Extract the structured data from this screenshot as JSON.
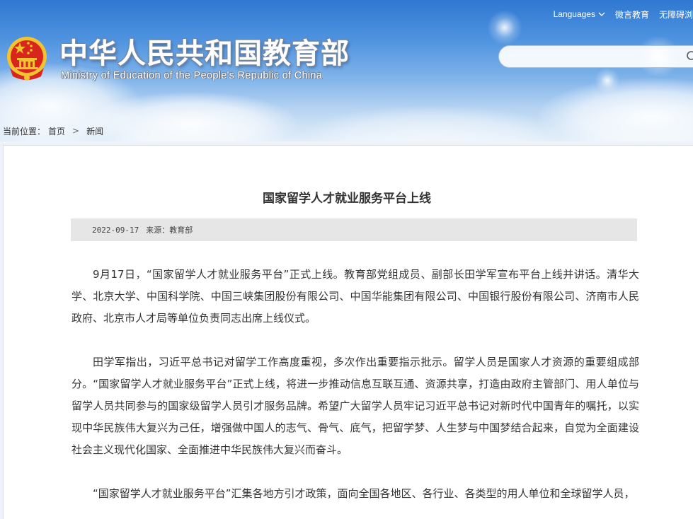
{
  "header": {
    "title": "中华人民共和国教育部",
    "subtitle": "Ministry of Education of the People's Republic of China",
    "links": {
      "languages": "Languages",
      "wechat": "微言教育",
      "accessibility": "无障碍浏"
    },
    "search": {
      "placeholder": ""
    }
  },
  "breadcrumb": {
    "prefix": "当前位置：",
    "home": "首页",
    "current": "新闻"
  },
  "article": {
    "title": "国家留学人才就业服务平台上线",
    "date": "2022-09-17",
    "source": "来源：教育部",
    "paragraphs": [
      "9月17日，“国家留学人才就业服务平台”正式上线。教育部党组成员、副部长田学军宣布平台上线并讲话。清华大学、北京大学、中国科学院、中国三峡集团股份有限公司、中国华能集团有限公司、中国银行股份有限公司、济南市人民政府、北京市人才局等单位负责同志出席上线仪式。",
      "田学军指出，习近平总书记对留学工作高度重视，多次作出重要指示批示。留学人员是国家人才资源的重要组成部分。“国家留学人才就业服务平台”正式上线，将进一步推动信息互联互通、资源共享，打造由政府主管部门、用人单位与留学人员共同参与的国家级留学人员引才服务品牌。希望广大留学人员牢记习近平总书记对新时代中国青年的嘱托，以实现中华民族伟大复兴为己任，增强做中国人的志气、骨气、底气，把留学梦、人生梦与中国梦结合起来，自觉为全面建设社会主义现代化国家、全面推进中华民族伟大复兴而奋斗。",
      "“国家留学人才就业服务平台”汇集各地方引才政策，面向全国各地区、各行业、各类型的用人单位和全球留学人员，"
    ]
  },
  "colors": {
    "header_top": "#2f78d2",
    "header_bottom": "#e3eef9",
    "emblem_red": "#d9261c",
    "emblem_gold": "#f2c230"
  }
}
